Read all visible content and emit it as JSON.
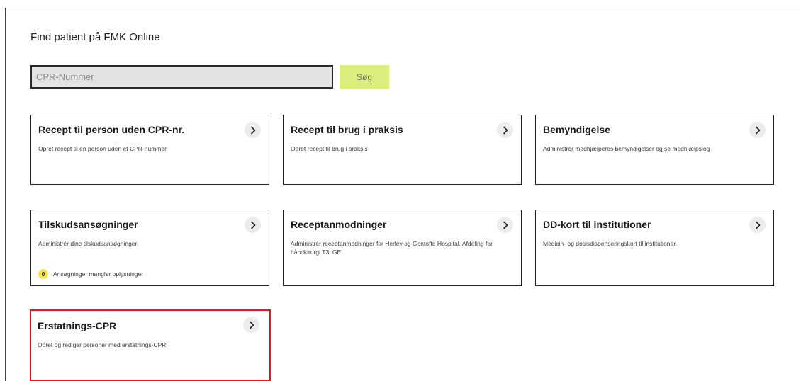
{
  "page": {
    "title": "Find patient på FMK Online"
  },
  "search": {
    "placeholder": "CPR-Nummer",
    "value": "",
    "button_label": "Søg"
  },
  "colors": {
    "accent_button": "#dbee7e",
    "highlight": "#e01b1b",
    "badge": "#f4e34c"
  },
  "cards": [
    {
      "title": "Recept til person uden CPR-nr.",
      "description": "Opret recept til en person uden et CPR-nummer",
      "icon": "chevron-right-icon"
    },
    {
      "title": "Recept til brug i praksis",
      "description": "Opret recept til brug i praksis",
      "icon": "chevron-right-icon"
    },
    {
      "title": "Bemyndigelse",
      "description": "Administrér medhjælperes bemyndigelser og se medhjælpslog",
      "icon": "chevron-right-icon"
    },
    {
      "title": "Tilskudsansøgninger",
      "description": "Administrér dine tilskudsansøgninger.",
      "status_count": "0",
      "status_text": "Ansøgninger mangler oplysninger",
      "icon": "chevron-right-icon"
    },
    {
      "title": "Receptanmodninger",
      "description": "Administrér receptanmodninger for Herlev og Gentofte Hospital, Afdeling for håndkirurgi T3, GE",
      "icon": "chevron-right-icon"
    },
    {
      "title": "DD-kort til institutioner",
      "description": "Medicin- og dosisdispenseringskort til institutioner.",
      "icon": "chevron-right-icon"
    },
    {
      "title": "Erstatnings-CPR",
      "description": "Opret og rediger personer med erstatnings-CPR",
      "icon": "chevron-right-icon",
      "highlighted": true
    }
  ]
}
